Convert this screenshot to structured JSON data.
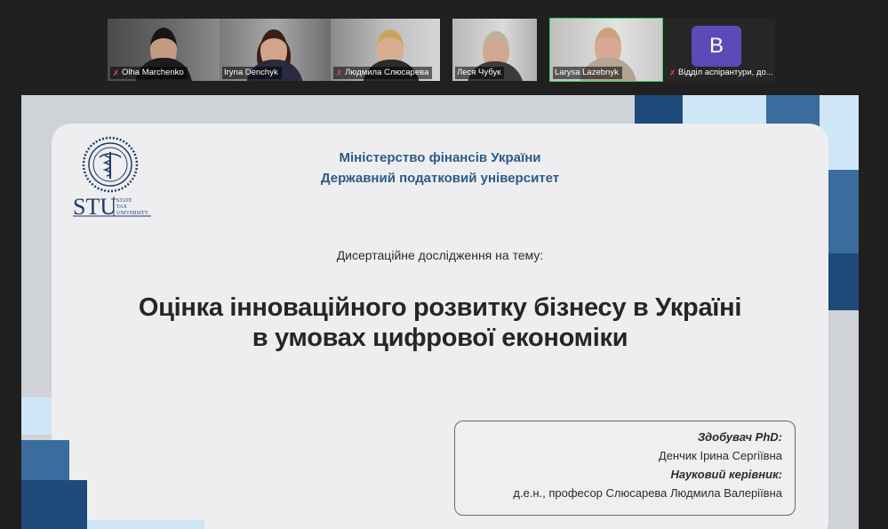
{
  "participants": [
    {
      "name": "Olha Marchenko",
      "muted": true
    },
    {
      "name": "Iryna Denchyk",
      "muted": false
    },
    {
      "name": "Людмила Слюсарева",
      "muted": true
    },
    {
      "name": "Леся Чубук",
      "muted": false
    },
    {
      "name": "Larysa Lazebnyk",
      "muted": false,
      "active": true
    },
    {
      "name": "Відділ аспірантури, до...",
      "muted": true,
      "avatar_letter": "B"
    }
  ],
  "slide": {
    "ministry": "Міністерство фінансів України",
    "university": "Державний податковий університет",
    "logo_text": "STU",
    "logo_small": [
      "STATE",
      "TAX",
      "UNIVERSITY"
    ],
    "subtitle": "Дисертаційне дослідження на тему:",
    "title_line1": "Оцінка інноваційного розвитку бізнесу в Україні",
    "title_line2": "в умовах цифрової економіки",
    "applicant_label": "Здобувач PhD:",
    "applicant_name": "Денчик Ірина Сергіївна",
    "advisor_label": "Науковий керівник:",
    "advisor_name": "д.е.н., професор Слюсарева Людмила Валеріївна"
  },
  "colors": {
    "accent_dark": "#1f4a7a",
    "accent_mid": "#3a6d9e",
    "accent_light": "#cfe6f7",
    "active_border": "#3fcf6a",
    "avatar": "#5b4ab8"
  }
}
